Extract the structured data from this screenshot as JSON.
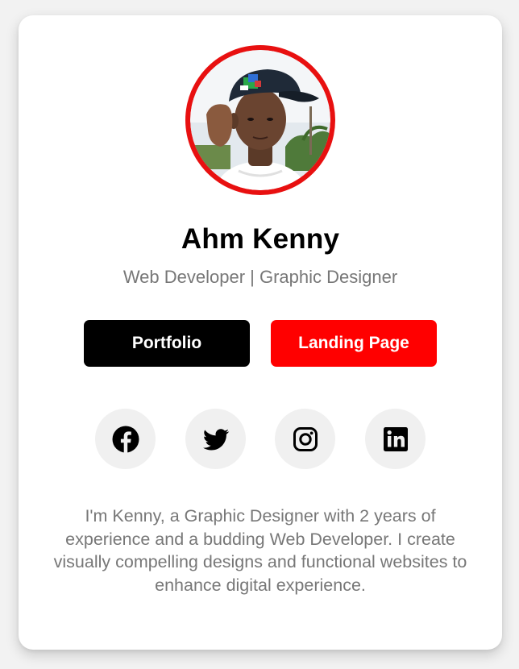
{
  "profile": {
    "name": "Ahm Kenny",
    "role": "Web Developer | Graphic Designer",
    "avatar_border_color": "#e81010"
  },
  "buttons": {
    "portfolio_label": "Portfolio",
    "landing_label": "Landing Page"
  },
  "social": [
    {
      "icon": "facebook-icon"
    },
    {
      "icon": "twitter-icon"
    },
    {
      "icon": "instagram-icon"
    },
    {
      "icon": "linkedin-icon"
    }
  ],
  "bio": "I'm Kenny, a Graphic Designer with 2 years of experience and a budding Web Developer. I create visually compelling designs and functional websites to enhance digital experience.",
  "colors": {
    "primary": "#000000",
    "accent": "#ff0000",
    "muted_text": "#777777",
    "social_bg": "#f0f0f0"
  }
}
